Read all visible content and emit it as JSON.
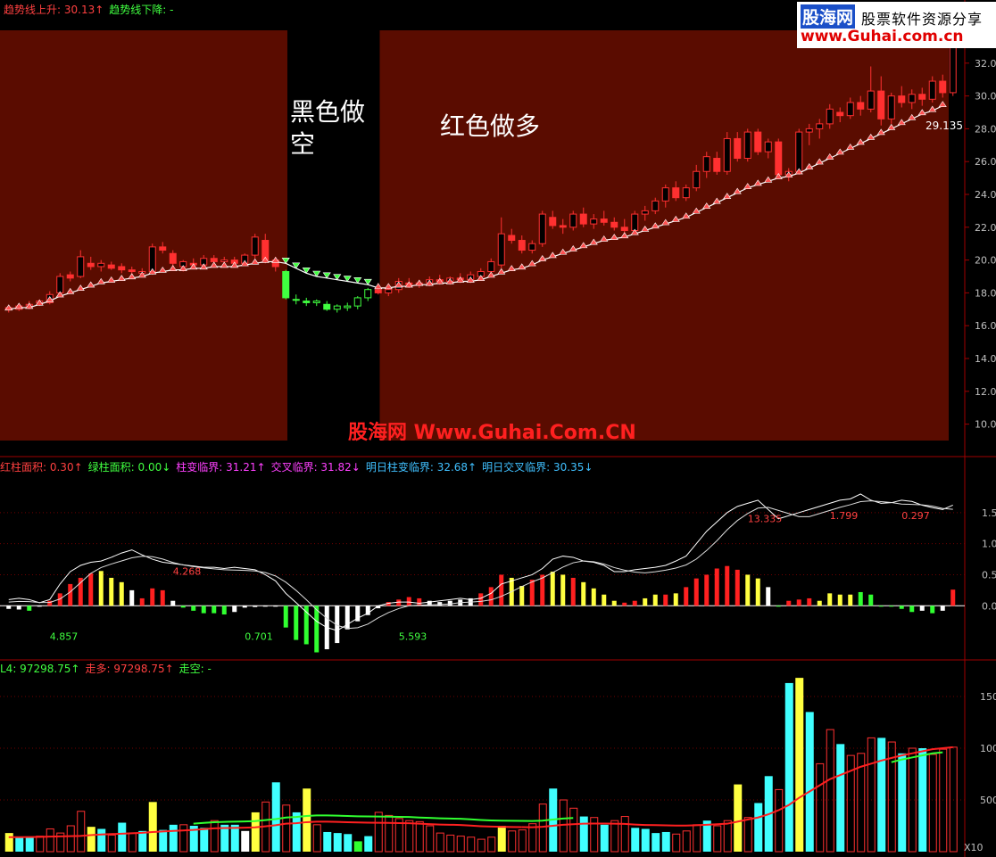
{
  "header_main": [
    {
      "text": "趋势线上升: 30.13↑",
      "color": "#ff4040"
    },
    {
      "text": "趋势线下降: -",
      "color": "#40ff40"
    }
  ],
  "header_ind": [
    {
      "text": "红柱面积: 0.30↑",
      "color": "#ff4040"
    },
    {
      "text": "绿柱面积: 0.00↓",
      "color": "#40ff40"
    },
    {
      "text": "柱变临界: 31.21↑",
      "color": "#ff40ff"
    },
    {
      "text": "交叉临界: 31.82↓",
      "color": "#ff40ff"
    },
    {
      "text": "明日柱变临界: 32.68↑",
      "color": "#40c0ff"
    },
    {
      "text": "明日交叉临界: 30.35↓",
      "color": "#40c0ff"
    }
  ],
  "header_vol": [
    {
      "text": "L4: 97298.75↑",
      "color": "#40ff40"
    },
    {
      "text": "走多: 97298.75↑",
      "color": "#ff4040"
    },
    {
      "text": "走空: -",
      "color": "#40ff40"
    }
  ],
  "annotations": {
    "short_label": "黑色做空",
    "long_label": "红色做多",
    "watermark": "股海网 Www.Guhai.Com.CN",
    "last_value": "29.135"
  },
  "logo": {
    "brand": "股海网",
    "slogan": "股票软件资源分享",
    "url": "www.Guhai.com.cn"
  },
  "chart_data": [
    {
      "type": "candlestick",
      "name": "price",
      "y_ticks": [
        "10.0",
        "12.0",
        "14.0",
        "16.0",
        "18.0",
        "20.0",
        "22.0",
        "24.0",
        "26.0",
        "28.0",
        "30.0",
        "32.0"
      ],
      "ylim": [
        9,
        34
      ],
      "regions": [
        {
          "from": 0,
          "to": 27,
          "color": "#5a0c00"
        },
        {
          "from": 28,
          "to": 36,
          "color": "#000000"
        },
        {
          "from": 37,
          "to": 91,
          "color": "#5a0c00"
        }
      ],
      "candles": [
        [
          17.0,
          17.2,
          16.8,
          17.1
        ],
        [
          17.0,
          17.3,
          16.9,
          17.2
        ],
        [
          17.2,
          17.5,
          17.0,
          17.3
        ],
        [
          17.4,
          17.6,
          17.2,
          17.5
        ],
        [
          17.4,
          18.1,
          17.3,
          17.9
        ],
        [
          18.0,
          19.2,
          17.9,
          19.0
        ],
        [
          19.1,
          19.3,
          18.7,
          18.9
        ],
        [
          19.0,
          20.6,
          18.9,
          20.2
        ],
        [
          19.8,
          20.2,
          19.4,
          19.6
        ],
        [
          19.6,
          20.0,
          19.3,
          19.8
        ],
        [
          19.7,
          19.9,
          19.4,
          19.5
        ],
        [
          19.6,
          19.8,
          19.2,
          19.4
        ],
        [
          19.4,
          19.6,
          19.1,
          19.3
        ],
        [
          19.2,
          19.5,
          19.0,
          19.3
        ],
        [
          19.3,
          21.0,
          19.1,
          20.8
        ],
        [
          20.8,
          21.1,
          20.4,
          20.6
        ],
        [
          20.4,
          20.6,
          19.6,
          19.8
        ],
        [
          19.6,
          20.0,
          19.3,
          19.9
        ],
        [
          19.8,
          20.1,
          19.5,
          19.7
        ],
        [
          19.7,
          20.3,
          19.6,
          20.1
        ],
        [
          20.1,
          20.3,
          19.8,
          19.9
        ],
        [
          19.9,
          20.2,
          19.6,
          20.0
        ],
        [
          20.0,
          20.2,
          19.7,
          19.8
        ],
        [
          19.8,
          20.4,
          19.7,
          20.3
        ],
        [
          20.3,
          21.6,
          20.1,
          21.4
        ],
        [
          21.2,
          21.6,
          19.8,
          20.0
        ],
        [
          20.0,
          20.2,
          19.3,
          19.6
        ],
        [
          19.3,
          19.4,
          17.6,
          17.7
        ],
        [
          17.6,
          17.9,
          17.3,
          17.6
        ],
        [
          17.5,
          17.7,
          17.2,
          17.4
        ],
        [
          17.4,
          17.6,
          17.2,
          17.5
        ],
        [
          17.3,
          17.5,
          16.9,
          17.0
        ],
        [
          17.0,
          17.3,
          16.8,
          17.2
        ],
        [
          17.1,
          17.4,
          16.9,
          17.2
        ],
        [
          17.2,
          17.8,
          17.0,
          17.7
        ],
        [
          17.7,
          18.3,
          17.5,
          18.2
        ],
        [
          18.2,
          18.6,
          17.9,
          18.0
        ],
        [
          18.0,
          18.3,
          17.8,
          18.2
        ],
        [
          18.2,
          18.9,
          18.0,
          18.7
        ],
        [
          18.6,
          18.9,
          18.3,
          18.5
        ],
        [
          18.5,
          18.8,
          18.3,
          18.6
        ],
        [
          18.6,
          19.0,
          18.4,
          18.8
        ],
        [
          18.8,
          19.1,
          18.5,
          18.7
        ],
        [
          18.7,
          19.0,
          18.5,
          18.9
        ],
        [
          18.9,
          19.2,
          18.6,
          18.8
        ],
        [
          18.8,
          19.3,
          18.6,
          19.1
        ],
        [
          19.0,
          19.5,
          18.8,
          19.3
        ],
        [
          19.3,
          20.1,
          19.1,
          19.9
        ],
        [
          19.7,
          22.6,
          19.5,
          21.6
        ],
        [
          21.5,
          21.9,
          21.0,
          21.2
        ],
        [
          21.2,
          21.5,
          20.4,
          20.6
        ],
        [
          20.6,
          21.2,
          20.4,
          21.0
        ],
        [
          21.0,
          23.0,
          20.8,
          22.8
        ],
        [
          22.6,
          23.0,
          21.9,
          22.1
        ],
        [
          22.1,
          22.5,
          21.6,
          22.0
        ],
        [
          22.0,
          23.0,
          21.8,
          22.8
        ],
        [
          22.8,
          23.2,
          22.0,
          22.2
        ],
        [
          22.2,
          22.8,
          21.9,
          22.5
        ],
        [
          22.5,
          23.0,
          22.1,
          22.3
        ],
        [
          22.3,
          22.6,
          21.8,
          22.0
        ],
        [
          22.0,
          22.5,
          21.6,
          21.8
        ],
        [
          21.8,
          23.0,
          21.6,
          22.8
        ],
        [
          22.8,
          23.3,
          22.4,
          23.0
        ],
        [
          23.0,
          23.8,
          22.8,
          23.6
        ],
        [
          23.6,
          24.6,
          23.2,
          24.4
        ],
        [
          24.4,
          24.8,
          23.6,
          23.8
        ],
        [
          23.8,
          24.6,
          23.6,
          24.4
        ],
        [
          24.4,
          25.8,
          24.2,
          25.4
        ],
        [
          25.4,
          26.6,
          25.0,
          26.3
        ],
        [
          26.2,
          26.6,
          25.2,
          25.4
        ],
        [
          25.4,
          27.8,
          25.2,
          27.4
        ],
        [
          27.4,
          27.8,
          26.0,
          26.2
        ],
        [
          26.2,
          28.0,
          26.0,
          27.8
        ],
        [
          27.8,
          28.0,
          26.4,
          26.6
        ],
        [
          26.6,
          27.4,
          26.2,
          27.2
        ],
        [
          27.2,
          27.4,
          25.0,
          25.2
        ],
        [
          25.2,
          25.6,
          24.8,
          25.4
        ],
        [
          25.4,
          28.0,
          25.2,
          27.8
        ],
        [
          27.8,
          28.3,
          27.0,
          28.0
        ],
        [
          28.0,
          28.6,
          27.4,
          28.3
        ],
        [
          28.3,
          29.5,
          28.0,
          29.2
        ],
        [
          29.0,
          29.3,
          28.4,
          28.8
        ],
        [
          28.8,
          29.9,
          28.6,
          29.6
        ],
        [
          29.6,
          30.0,
          28.8,
          29.2
        ],
        [
          29.2,
          31.8,
          29.0,
          30.3
        ],
        [
          30.3,
          31.2,
          28.2,
          28.6
        ],
        [
          28.6,
          30.2,
          28.3,
          30.0
        ],
        [
          30.0,
          30.6,
          29.3,
          29.6
        ],
        [
          29.6,
          30.4,
          29.2,
          30.1
        ],
        [
          30.1,
          30.5,
          29.4,
          29.8
        ],
        [
          29.8,
          31.2,
          29.6,
          30.9
        ],
        [
          30.9,
          31.3,
          29.9,
          30.2
        ],
        [
          30.2,
          33.4,
          30.0,
          33.2
        ]
      ],
      "trend_line": [
        17.0,
        17.1,
        17.1,
        17.3,
        17.5,
        17.8,
        18.0,
        18.2,
        18.4,
        18.6,
        18.7,
        18.8,
        18.9,
        19.0,
        19.2,
        19.3,
        19.4,
        19.4,
        19.5,
        19.5,
        19.6,
        19.6,
        19.6,
        19.7,
        19.8,
        19.9,
        19.9,
        19.8,
        19.5,
        19.2,
        19.0,
        18.9,
        18.8,
        18.7,
        18.6,
        18.5,
        18.3,
        18.3,
        18.4,
        18.4,
        18.5,
        18.5,
        18.6,
        18.6,
        18.7,
        18.7,
        18.8,
        19.0,
        19.2,
        19.4,
        19.5,
        19.7,
        20.0,
        20.2,
        20.4,
        20.6,
        20.8,
        21.0,
        21.2,
        21.3,
        21.4,
        21.6,
        21.8,
        22.0,
        22.2,
        22.4,
        22.6,
        22.9,
        23.2,
        23.5,
        23.8,
        24.1,
        24.4,
        24.6,
        24.8,
        25.0,
        25.1,
        25.3,
        25.6,
        25.9,
        26.2,
        26.5,
        26.8,
        27.1,
        27.4,
        27.7,
        28.0,
        28.3,
        28.6,
        28.9,
        29.1,
        29.4
      ]
    },
    {
      "type": "bar",
      "name": "macd",
      "y_ticks": [
        "1.5",
        "1.0",
        "0.5",
        "0.0"
      ],
      "ylim": [
        -0.8,
        2.0
      ],
      "value_labels": [
        {
          "text": "4.857",
          "i": 4,
          "v": -0.55,
          "color": "#40ff40"
        },
        {
          "text": "4.268",
          "i": 16,
          "v": 0.5,
          "color": "#ff4040"
        },
        {
          "text": "0.701",
          "i": 23,
          "v": -0.55,
          "color": "#40ff40"
        },
        {
          "text": "5.593",
          "i": 38,
          "v": -0.55,
          "color": "#40ff40"
        },
        {
          "text": "13.335",
          "i": 72,
          "v": 1.35,
          "color": "#ff4040"
        },
        {
          "text": "1.799",
          "i": 80,
          "v": 1.4,
          "color": "#ff4040"
        },
        {
          "text": "0.297",
          "i": 87,
          "v": 1.4,
          "color": "#ff4040"
        }
      ],
      "values": [
        -0.05,
        -0.06,
        -0.08,
        0.0,
        0.08,
        0.2,
        0.35,
        0.45,
        0.52,
        0.56,
        0.45,
        0.38,
        0.25,
        0.12,
        0.28,
        0.25,
        0.08,
        -0.03,
        -0.08,
        -0.12,
        -0.12,
        -0.14,
        -0.1,
        -0.03,
        -0.02,
        -0.01,
        0.0,
        -0.35,
        -0.55,
        -0.62,
        -0.75,
        -0.7,
        -0.6,
        -0.38,
        -0.25,
        -0.15,
        -0.04,
        0.06,
        0.1,
        0.14,
        0.12,
        0.08,
        0.06,
        0.08,
        0.1,
        0.12,
        0.2,
        0.3,
        0.5,
        0.45,
        0.32,
        0.42,
        0.5,
        0.55,
        0.5,
        0.45,
        0.38,
        0.28,
        0.18,
        0.08,
        0.05,
        0.08,
        0.12,
        0.18,
        0.18,
        0.2,
        0.3,
        0.44,
        0.5,
        0.6,
        0.64,
        0.58,
        0.5,
        0.44,
        0.3,
        0.0,
        0.08,
        0.1,
        0.12,
        0.08,
        0.2,
        0.18,
        0.18,
        0.22,
        0.18,
        0.0,
        0.0,
        -0.05,
        -0.1,
        -0.08,
        -0.12,
        -0.08,
        0.26
      ],
      "colors": [
        "w",
        "w",
        "g",
        "w",
        "r",
        "r",
        "r",
        "r",
        "r",
        "y",
        "y",
        "y",
        "w",
        "r",
        "r",
        "r",
        "w",
        "g",
        "g",
        "g",
        "g",
        "g",
        "w",
        "w",
        "w",
        "w",
        "w",
        "g",
        "g",
        "g",
        "g",
        "w",
        "w",
        "w",
        "w",
        "w",
        "w",
        "r",
        "r",
        "r",
        "r",
        "w",
        "w",
        "w",
        "w",
        "w",
        "r",
        "r",
        "r",
        "y",
        "y",
        "r",
        "r",
        "y",
        "y",
        "r",
        "y",
        "y",
        "y",
        "y",
        "r",
        "r",
        "y",
        "y",
        "r",
        "y",
        "r",
        "r",
        "r",
        "r",
        "r",
        "r",
        "y",
        "y",
        "w",
        "g",
        "r",
        "r",
        "r",
        "y",
        "y",
        "y",
        "y",
        "g",
        "g",
        "g",
        "g",
        "g",
        "g",
        "w",
        "g",
        "w",
        "r"
      ],
      "dif": [
        0.1,
        0.12,
        0.1,
        0.05,
        0.1,
        0.35,
        0.55,
        0.65,
        0.7,
        0.72,
        0.78,
        0.85,
        0.9,
        0.82,
        0.75,
        0.7,
        0.68,
        0.66,
        0.64,
        0.62,
        0.62,
        0.6,
        0.62,
        0.6,
        0.58,
        0.5,
        0.4,
        0.2,
        0.05,
        -0.1,
        -0.25,
        -0.35,
        -0.4,
        -0.3,
        -0.2,
        -0.12,
        0.0,
        0.04,
        0.06,
        0.06,
        0.04,
        0.06,
        0.08,
        0.1,
        0.12,
        0.1,
        0.12,
        0.2,
        0.35,
        0.4,
        0.45,
        0.5,
        0.6,
        0.75,
        0.8,
        0.78,
        0.72,
        0.7,
        0.65,
        0.55,
        0.55,
        0.58,
        0.6,
        0.62,
        0.65,
        0.72,
        0.8,
        1.0,
        1.2,
        1.35,
        1.5,
        1.6,
        1.65,
        1.7,
        1.55,
        1.4,
        1.45,
        1.5,
        1.55,
        1.6,
        1.65,
        1.7,
        1.72,
        1.8,
        1.7,
        1.65,
        1.66,
        1.7,
        1.68,
        1.62,
        1.58,
        1.55,
        1.62
      ]
    },
    {
      "type": "bar",
      "name": "volume",
      "y_ticks": [
        "1500",
        "1000",
        "500"
      ],
      "ylim": [
        0,
        1750
      ],
      "unit_label": "X10",
      "values": [
        180,
        140,
        140,
        150,
        220,
        180,
        250,
        390,
        240,
        220,
        160,
        280,
        180,
        200,
        480,
        210,
        260,
        260,
        250,
        230,
        300,
        260,
        260,
        200,
        380,
        480,
        670,
        450,
        380,
        610,
        260,
        190,
        180,
        170,
        100,
        150,
        380,
        350,
        320,
        300,
        290,
        250,
        180,
        160,
        150,
        140,
        120,
        140,
        250,
        200,
        210,
        270,
        460,
        610,
        500,
        420,
        340,
        330,
        260,
        300,
        340,
        230,
        220,
        180,
        190,
        170,
        200,
        260,
        300,
        250,
        300,
        650,
        330,
        470,
        730,
        600,
        1630,
        1680,
        1350,
        850,
        1180,
        1040,
        930,
        950,
        1100,
        1100,
        1060,
        950,
        1000,
        1000,
        940,
        990,
        1010
      ],
      "colors": [
        "y",
        "c",
        "c",
        "h",
        "h",
        "h",
        "h",
        "h",
        "y",
        "c",
        "h",
        "c",
        "h",
        "c",
        "y",
        "c",
        "c",
        "h",
        "c",
        "c",
        "h",
        "c",
        "c",
        "w",
        "y",
        "h",
        "c",
        "h",
        "c",
        "y",
        "h",
        "c",
        "c",
        "c",
        "g",
        "c",
        "h",
        "h",
        "h",
        "h",
        "h",
        "h",
        "h",
        "h",
        "h",
        "h",
        "h",
        "h",
        "y",
        "h",
        "h",
        "h",
        "h",
        "c",
        "h",
        "h",
        "c",
        "h",
        "c",
        "h",
        "h",
        "c",
        "c",
        "c",
        "c",
        "h",
        "h",
        "h",
        "c",
        "h",
        "h",
        "y",
        "h",
        "c",
        "c",
        "h",
        "c",
        "y",
        "c",
        "h",
        "h",
        "c",
        "h",
        "h",
        "h",
        "c",
        "h",
        "c",
        "h",
        "c",
        "h",
        "h",
        "h"
      ],
      "ma": [
        140,
        140,
        141,
        142,
        145,
        148,
        150,
        152,
        160,
        166,
        170,
        174,
        178,
        182,
        190,
        195,
        200,
        205,
        210,
        218,
        225,
        228,
        230,
        232,
        235,
        245,
        255,
        270,
        275,
        285,
        290,
        290,
        288,
        285,
        282,
        280,
        279,
        278,
        276,
        275,
        270,
        266,
        262,
        260,
        258,
        252,
        246,
        242,
        240,
        238,
        237,
        236,
        240,
        250,
        260,
        265,
        270,
        272,
        272,
        270,
        268,
        262,
        258,
        256,
        254,
        252,
        252,
        255,
        260,
        265,
        270,
        290,
        310,
        330,
        360,
        400,
        450,
        520,
        580,
        640,
        700,
        740,
        780,
        820,
        850,
        880,
        905,
        930,
        950,
        970,
        990,
        1000,
        1010
      ]
    }
  ]
}
